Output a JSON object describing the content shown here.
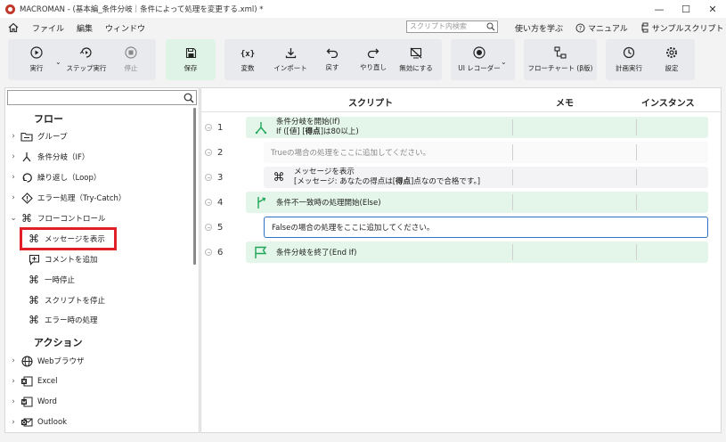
{
  "window": {
    "title": "MACROMAN - (基本編_条件分岐｜条件によって処理を変更する.xml) *",
    "minimize": "—",
    "maximize": "☐",
    "close": "✕"
  },
  "menubar": {
    "items": [
      "ファイル",
      "編集",
      "ウィンドウ"
    ],
    "search_placeholder": "スクリプト内検索",
    "help_links": [
      "使い方を学ぶ",
      "マニュアル",
      "サンプルスクリプト"
    ]
  },
  "toolbar": {
    "run": "実行",
    "step": "ステップ実行",
    "stop": "停止",
    "save": "保存",
    "variable": "変数",
    "import": "インポート",
    "undo": "戻す",
    "redo": "やり直し",
    "disable": "無効にする",
    "ui_recorder": "UI レコーダー",
    "flowchart": "フローチャート (β版)",
    "schedule": "計画実行",
    "settings": "設定"
  },
  "left_panel": {
    "search_value": "",
    "section_flow": "フロー",
    "flow_items": [
      "グループ",
      "条件分岐（IF）",
      "繰り返し（Loop）",
      "エラー処理（Try-Catch）",
      "フローコントロール"
    ],
    "flow_control_children": [
      "メッセージを表示",
      "コメントを追加",
      "一時停止",
      "スクリプトを停止",
      "エラー時の処理"
    ],
    "section_action": "アクション",
    "action_items": [
      "Webブラウザ",
      "Excel",
      "Word",
      "Outlook"
    ]
  },
  "main": {
    "headers": {
      "script": "スクリプト",
      "memo": "メモ",
      "instance": "インスタンス"
    },
    "rows": [
      {
        "num": "1",
        "line1": "条件分岐を開始(If)",
        "line2_pre": "If ([値] [",
        "line2_bold": "得点",
        "line2_post": "]は80以上)"
      },
      {
        "num": "2",
        "text": "Trueの場合の処理をここに追加してください。"
      },
      {
        "num": "3",
        "line1": "メッセージを表示",
        "line2_pre": "[メッセージ: あなたの得点は[",
        "line2_bold": "得点",
        "line2_post": "]点なので合格です。]"
      },
      {
        "num": "4",
        "text": "条件不一致時の処理開始(Else)"
      },
      {
        "num": "5",
        "text": "Falseの場合の処理をここに追加してください。"
      },
      {
        "num": "6",
        "text": "条件分岐を終了(End If)"
      }
    ]
  },
  "colors": {
    "accent_green": "#1fa65a",
    "selected_border": "#2f73c7",
    "highlight_red": "#e01f26"
  }
}
